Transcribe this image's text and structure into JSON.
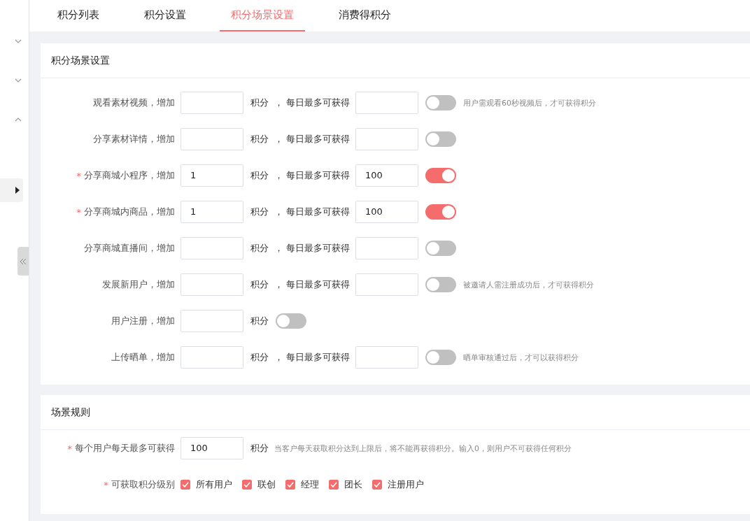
{
  "tabs": [
    {
      "label": "积分列表",
      "selected": false
    },
    {
      "label": "积分设置",
      "selected": false
    },
    {
      "label": "积分场景设置",
      "selected": true
    },
    {
      "label": "消费得积分",
      "selected": false
    }
  ],
  "scene_card": {
    "title": "积分场景设置",
    "rows": [
      {
        "kind": "daily_limit",
        "label": "观看素材视频，增加",
        "points": "",
        "unit": "积分",
        "comma": "，",
        "max_label": "每日最多可获得",
        "max": "",
        "on": false,
        "hint": "用户需观看60秒视频后，才可获得积分"
      },
      {
        "kind": "daily_limit",
        "label": "分享素材详情，增加",
        "points": "",
        "unit": "积分",
        "comma": "，",
        "max_label": "每日最多可获得",
        "max": "",
        "on": false
      },
      {
        "kind": "daily_limit",
        "mark": "*",
        "label": "分享商城小程序，增加",
        "points": "1",
        "unit": "积分",
        "comma": "，",
        "max_label": "每日最多可获得",
        "max": "100",
        "on": true
      },
      {
        "kind": "daily_limit",
        "mark": "*",
        "label": "分享商城内商品，增加",
        "points": "1",
        "unit": "积分",
        "comma": "，",
        "max_label": "每日最多可获得",
        "max": "100",
        "on": true
      },
      {
        "kind": "daily_limit",
        "label": "分享商城直播间，增加",
        "points": "",
        "unit": "积分",
        "comma": "，",
        "max_label": "每日最多可获得",
        "max": "",
        "on": false
      },
      {
        "kind": "daily_limit",
        "label": "发展新用户，增加",
        "points": "",
        "unit": "积分",
        "comma": "，",
        "max_label": "每日最多可获得",
        "max": "",
        "on": false,
        "hint": "被邀请人需注册成功后，才可获得积分"
      },
      {
        "kind": "single",
        "label": "用户注册，增加",
        "points": "",
        "unit": "积分",
        "on": false
      },
      {
        "kind": "daily_limit",
        "label": "上传晒单，增加",
        "points": "",
        "unit": "积分",
        "comma": "，",
        "max_label": "每日最多可获得",
        "max": "",
        "on": false,
        "hint": "晒单审核通过后，才可以获得积分"
      }
    ]
  },
  "rules_card": {
    "title": "场景规则",
    "daily_cap": {
      "mark": "*",
      "label": "每个用户每天最多可获得",
      "value": "100",
      "unit": "积分",
      "hint": "当客户每天获取积分达到上限后，将不能再获得积分。输入0，则用户不可获得任何积分"
    },
    "levels": {
      "mark": "*",
      "label": "可获取积分级别",
      "options": [
        {
          "label": "所有用户",
          "checked": true
        },
        {
          "label": "联创",
          "checked": true
        },
        {
          "label": "经理",
          "checked": true
        },
        {
          "label": "团长",
          "checked": true
        },
        {
          "label": "注册用户",
          "checked": true
        }
      ]
    }
  }
}
